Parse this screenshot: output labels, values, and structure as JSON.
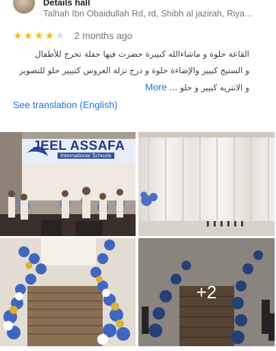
{
  "review": {
    "place_name": "Details hall",
    "place_address": "Talhah Ibn Obaidullah Rd, rd, Shibh al jazirah, Riya...",
    "rating": 4,
    "rating_max": 5,
    "time_ago": "2 months ago",
    "text_lines": [
      "القاعة حلوة و ماشاءالله كبييرة حضرت فيها حفلة تخرج للأطفال",
      "و الستيج كبيير والإضاءة حلوة و درج نزلة العروس كتييير حلو للتصوير",
      "و الانتريه كبيير و حلو ..."
    ],
    "more_label": "More",
    "translate_label": "See translation (English)"
  },
  "gallery": {
    "photo1_banner_title": "JEEL ASSAFA",
    "photo1_banner_subtitle": "International Schools",
    "more_photos_count": "+2"
  },
  "colors": {
    "star_on": "#fbbc04",
    "star_off": "#dadce0",
    "link": "#1a73e8",
    "secondary_text": "#70757a"
  }
}
